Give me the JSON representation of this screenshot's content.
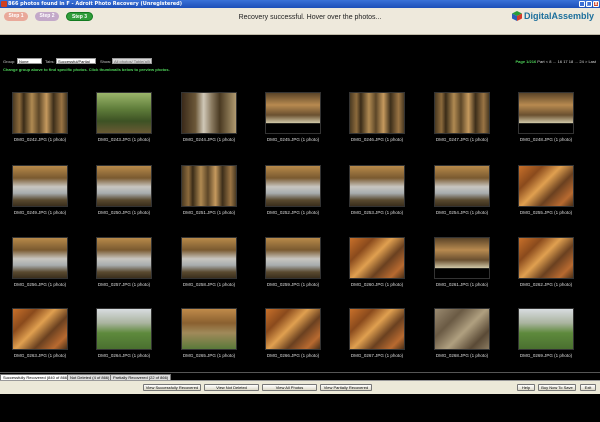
{
  "window": {
    "title": "866 photos found in F - Adroit Photo Recovery (Unregistered)",
    "buttons": [
      "_",
      "□",
      "x"
    ]
  },
  "steps": [
    {
      "label": "Step 1"
    },
    {
      "label": "Step 2"
    },
    {
      "label": "Step 3"
    }
  ],
  "status_message": "Recovery successful. Hover over the photos...",
  "logo": {
    "text": "DigitalAssembly",
    "colors": [
      "#2a9d3a",
      "#d63a2a",
      "#2c5fb8",
      "#f0b429"
    ]
  },
  "filters": {
    "group_label": "Group:",
    "group_value": "None",
    "tabs_label": "Tabs:",
    "tabs_value": "Successful/Partial",
    "show_label": "Show:",
    "show_value": "All photos/ Table(all)",
    "page_label": "Page 1/216",
    "page_nav": "Part < 8 … 16 17 18 … 24 > Last"
  },
  "hint": "Change group above to find specific photos. Click thumbnails below to preview photos.",
  "photos": [
    {
      "caption": "DMG_0242.JPG (1 photo)",
      "scene": "trees"
    },
    {
      "caption": "DMG_0243.JPG (1 photo)",
      "scene": "green"
    },
    {
      "caption": "DMG_0244.JPG (1 photo)",
      "scene": "house"
    },
    {
      "caption": "DMG_0245.JPG (1 photo)",
      "scene": "partial"
    },
    {
      "caption": "DMG_0246.JPG (1 photo)",
      "scene": "trees"
    },
    {
      "caption": "DMG_0247.JPG (1 photo)",
      "scene": "trees"
    },
    {
      "caption": "DMG_0248.JPG (1 photo)",
      "scene": "partial"
    },
    {
      "caption": "DMG_0249.JPG (1 photo)",
      "scene": "lake"
    },
    {
      "caption": "DMG_0250.JPG (1 photo)",
      "scene": "lake"
    },
    {
      "caption": "DMG_0251.JPG (1 photo)",
      "scene": "trees"
    },
    {
      "caption": "DMG_0252.JPG (1 photo)",
      "scene": "lake"
    },
    {
      "caption": "DMG_0253.JPG (1 photo)",
      "scene": "lake"
    },
    {
      "caption": "DMG_0254.JPG (1 photo)",
      "scene": "lake"
    },
    {
      "caption": "DMG_0255.JPG (1 photo)",
      "scene": "autumn"
    },
    {
      "caption": "DMG_0256.JPG (1 photo)",
      "scene": "lake"
    },
    {
      "caption": "DMG_0257.JPG (1 photo)",
      "scene": "lake"
    },
    {
      "caption": "DMG_0258.JPG (1 photo)",
      "scene": "lake"
    },
    {
      "caption": "DMG_0259.JPG (1 photo)",
      "scene": "lake"
    },
    {
      "caption": "DMG_0260.JPG (1 photo)",
      "scene": "autumn"
    },
    {
      "caption": "DMG_0261.JPG (1 photo)",
      "scene": "partial"
    },
    {
      "caption": "DMG_0262.JPG (1 photo)",
      "scene": "autumn"
    },
    {
      "caption": "DMG_0263.JPG (1 photo)",
      "scene": "autumn"
    },
    {
      "caption": "DMG_0264.JPG (1 photo)",
      "scene": "field"
    },
    {
      "caption": "DMG_0265.JPG (1 photo)",
      "scene": "path"
    },
    {
      "caption": "DMG_0266.JPG (1 photo)",
      "scene": "autumn"
    },
    {
      "caption": "DMG_0267.JPG (1 photo)",
      "scene": "autumn"
    },
    {
      "caption": "DMG_0268.JPG (1 photo)",
      "scene": "ground"
    },
    {
      "caption": "DMG_0269.JPG (1 photo)",
      "scene": "field"
    }
  ],
  "tabs": [
    {
      "label": "Successfully Recovered (840 of 866)"
    },
    {
      "label": "Not Deleted (4 of 866)"
    },
    {
      "label": "Partially Recovered (22 of 866)"
    }
  ],
  "bottom_buttons": {
    "view_success": "View Successfully Recovered",
    "view_not_deleted": "View Not Deleted",
    "view_all": "View All Photos",
    "view_partial": "View Partially Recovered",
    "help": "Help",
    "buy": "Buy Now To Save",
    "exit": "Exit"
  }
}
